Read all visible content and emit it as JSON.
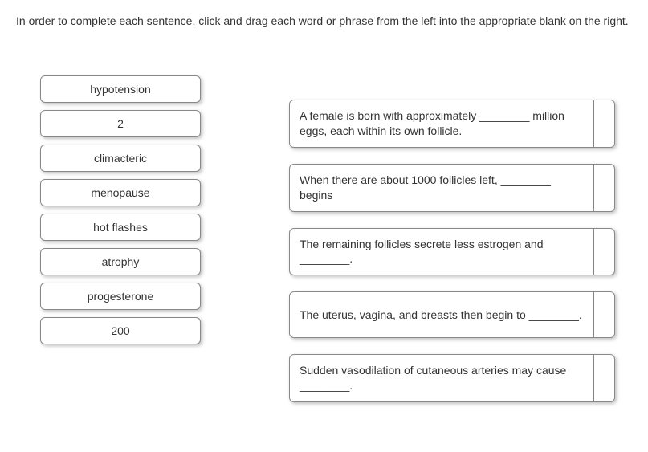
{
  "instruction": "In order to complete each sentence, click and drag each word or phrase from the left into the appropriate blank on the right.",
  "word_bank": [
    "hypotension",
    "2",
    "climacteric",
    "menopause",
    "hot flashes",
    "atrophy",
    "progesterone",
    "200"
  ],
  "sentences": [
    "A female is born with approximately ________ million eggs, each within its own follicle.",
    "When there are about 1000 follicles left, ________ begins",
    "The remaining follicles secrete less estrogen and ________.",
    "The uterus, vagina, and breasts then begin to ________.",
    "Sudden vasodilation of cutaneous arteries may cause ________."
  ]
}
